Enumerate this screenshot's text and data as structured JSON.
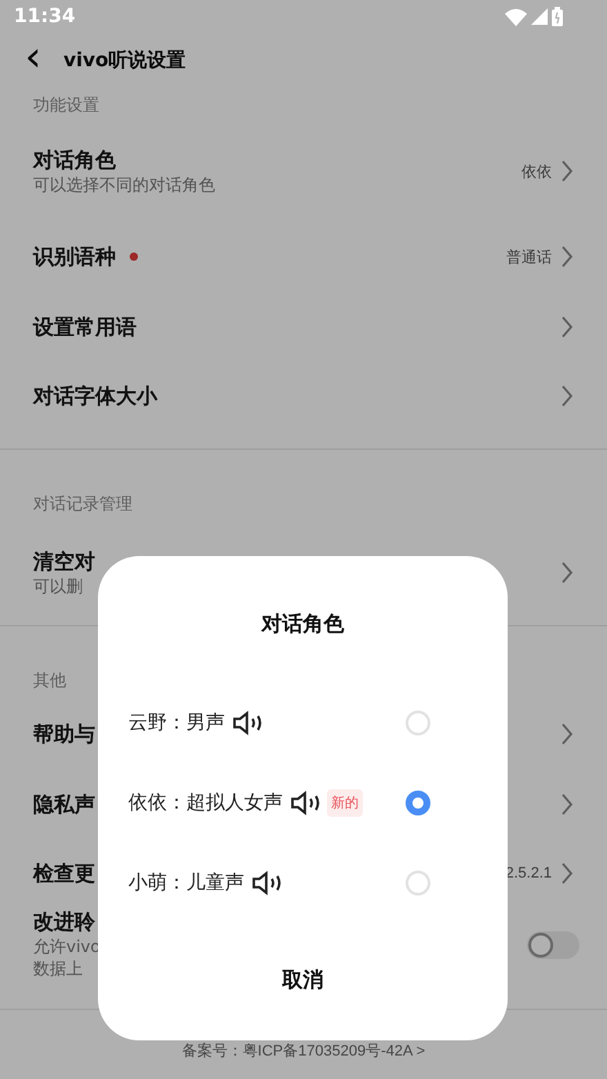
{
  "status_bar": {
    "time": "11:34"
  },
  "header": {
    "back": "‹",
    "title": "vivo听说设置"
  },
  "sections": [
    {
      "label": "功能设置",
      "items": [
        {
          "kind": "chevron",
          "title": "对话角色",
          "subtitle": "可以选择不同的对话角色",
          "value": "依依",
          "dot": false
        },
        {
          "kind": "chevron",
          "title": "识别语种",
          "value": "普通话",
          "dot": true
        },
        {
          "kind": "chevron",
          "title": "设置常用语",
          "dot": false
        },
        {
          "kind": "chevron",
          "title": "对话字体大小",
          "dot": false
        }
      ]
    },
    {
      "label": "对话记录管理",
      "items": [
        {
          "kind": "chevron",
          "title": "清空对",
          "subtitle": "可以删",
          "dot": false
        }
      ]
    },
    {
      "label": "其他",
      "items": [
        {
          "kind": "chevron",
          "title": "帮助与",
          "dot": false
        },
        {
          "kind": "chevron",
          "title": "隐私声",
          "dot": false
        },
        {
          "kind": "chevron",
          "title": "检查更",
          "value": "2.5.2.1",
          "dot": false
        },
        {
          "kind": "switch",
          "title": "改进聆",
          "subtitle": "允许vivo\n数据上",
          "on": false,
          "dot": false
        }
      ]
    }
  ],
  "footer": "备案号：粤ICP备17035209号-42A >",
  "dialog": {
    "title": "对话角色",
    "options": [
      {
        "label": "云野：男声",
        "selected": false
      },
      {
        "label": "依依：超拟人女声",
        "tag": "新的",
        "selected": true
      },
      {
        "label": "小萌：儿童声",
        "selected": false
      }
    ],
    "cancel": "取消"
  }
}
